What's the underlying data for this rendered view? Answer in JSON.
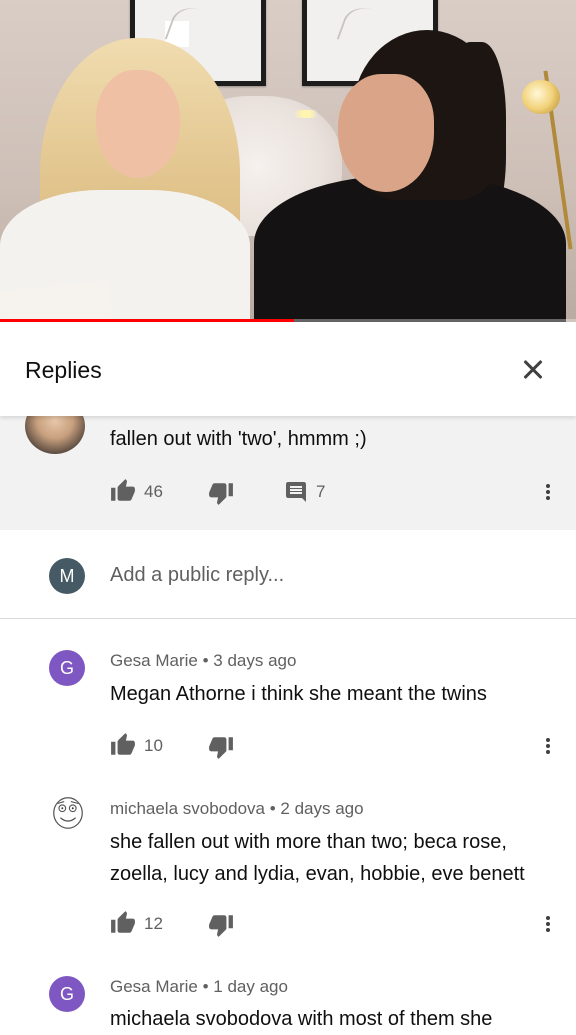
{
  "video": {
    "progress_fraction": 0.51
  },
  "header": {
    "title": "Replies"
  },
  "parent_comment": {
    "text": "fallen out with 'two', hmmm ;)",
    "likes": "46",
    "replies": "7"
  },
  "add_reply": {
    "avatar_letter": "M",
    "placeholder": "Add a public reply..."
  },
  "replies": [
    {
      "avatar_letter": "G",
      "author": "Gesa Marie",
      "time": "3 days ago",
      "text": "Megan Athorne i think she meant the twins",
      "likes": "10"
    },
    {
      "avatar_letter": "",
      "author": "michaela svobodova",
      "time": "2 days ago",
      "text": "she fallen out with more than two; beca rose, zoella, lucy and lydia, evan, hobbie, eve benett",
      "likes": "12"
    },
    {
      "avatar_letter": "G",
      "author": "Gesa Marie",
      "time": "1 day ago",
      "text": "michaela svobodova with most of them she"
    }
  ],
  "colors": {
    "progress": "#ff0000",
    "avatar_purple": "#7e57c2",
    "avatar_slate": "#455a64",
    "parent_bg": "#f2f2f2"
  },
  "icons": [
    "close-icon",
    "thumb-up-icon",
    "thumb-down-icon",
    "reply-comment-icon",
    "more-vert-icon"
  ]
}
